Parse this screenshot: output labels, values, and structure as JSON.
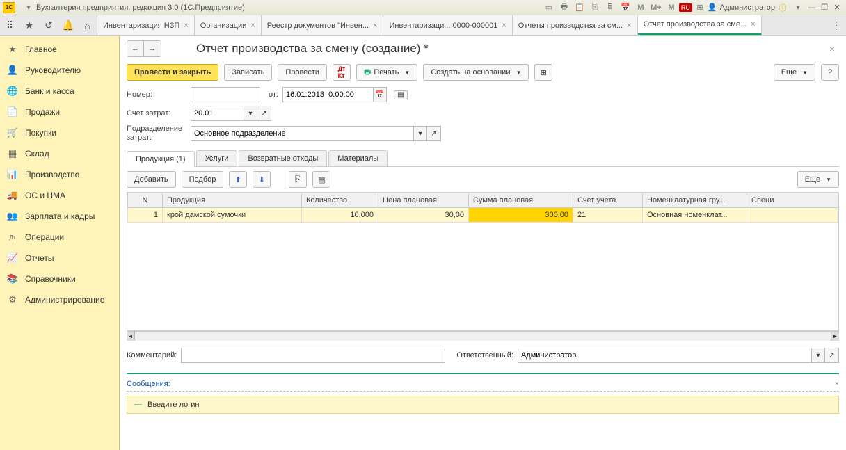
{
  "titlebar": {
    "app_title": "Бухгалтерия предприятия, редакция 3.0  (1С:Предприятие)",
    "lang": "RU",
    "user": "Администратор",
    "m1": "M",
    "m2": "M+",
    "m3": "M"
  },
  "tabs": [
    {
      "label": "Инвентаризация НЗП"
    },
    {
      "label": "Организации"
    },
    {
      "label": "Реестр документов \"Инвен..."
    },
    {
      "label": "Инвентаризаци... 0000-000001"
    },
    {
      "label": "Отчеты производства за см..."
    },
    {
      "label": "Отчет производства за сме...",
      "active": true
    }
  ],
  "sidebar": [
    {
      "icon": "★",
      "label": "Главное"
    },
    {
      "icon": "👤",
      "label": "Руководителю"
    },
    {
      "icon": "🌐",
      "label": "Банк и касса"
    },
    {
      "icon": "📄",
      "label": "Продажи"
    },
    {
      "icon": "🛒",
      "label": "Покупки"
    },
    {
      "icon": "▦",
      "label": "Склад"
    },
    {
      "icon": "📊",
      "label": "Производство"
    },
    {
      "icon": "🚚",
      "label": "ОС и НМА"
    },
    {
      "icon": "👥",
      "label": "Зарплата и кадры"
    },
    {
      "icon": "Дт",
      "label": "Операции"
    },
    {
      "icon": "📈",
      "label": "Отчеты"
    },
    {
      "icon": "📚",
      "label": "Справочники"
    },
    {
      "icon": "⚙",
      "label": "Администрирование"
    }
  ],
  "doc": {
    "title": "Отчет производства за смену (создание) *",
    "btn_post_close": "Провести и закрыть",
    "btn_save": "Записать",
    "btn_post": "Провести",
    "btn_print": "Печать",
    "btn_create_based": "Создать на основании",
    "btn_more": "Еще",
    "number_label": "Номер:",
    "number_value": "",
    "from_label": "от:",
    "date_value": "16.01.2018  0:00:00",
    "cost_account_label": "Счет затрат:",
    "cost_account_value": "20.01",
    "department_label": "Подразделение затрат:",
    "department_value": "Основное подразделение"
  },
  "subtabs": [
    {
      "label": "Продукция (1)",
      "active": true
    },
    {
      "label": "Услуги"
    },
    {
      "label": "Возвратные отходы"
    },
    {
      "label": "Материалы"
    }
  ],
  "table_toolbar": {
    "add": "Добавить",
    "pick": "Подбор",
    "more": "Еще"
  },
  "table": {
    "headers": [
      "N",
      "Продукция",
      "Количество",
      "Цена плановая",
      "Сумма плановая",
      "Счет учета",
      "Номенклатурная гру...",
      "Специ"
    ],
    "rows": [
      {
        "n": "1",
        "product": "крой дамской сумочки",
        "qty": "10,000",
        "price": "30,00",
        "sum": "300,00",
        "account": "21",
        "group": "Основная номенклат...",
        "spec": ""
      }
    ]
  },
  "footer": {
    "comment_label": "Комментарий:",
    "comment_value": "",
    "responsible_label": "Ответственный:",
    "responsible_value": "Администратор"
  },
  "messages": {
    "header": "Сообщения:",
    "item": "Введите логин"
  }
}
